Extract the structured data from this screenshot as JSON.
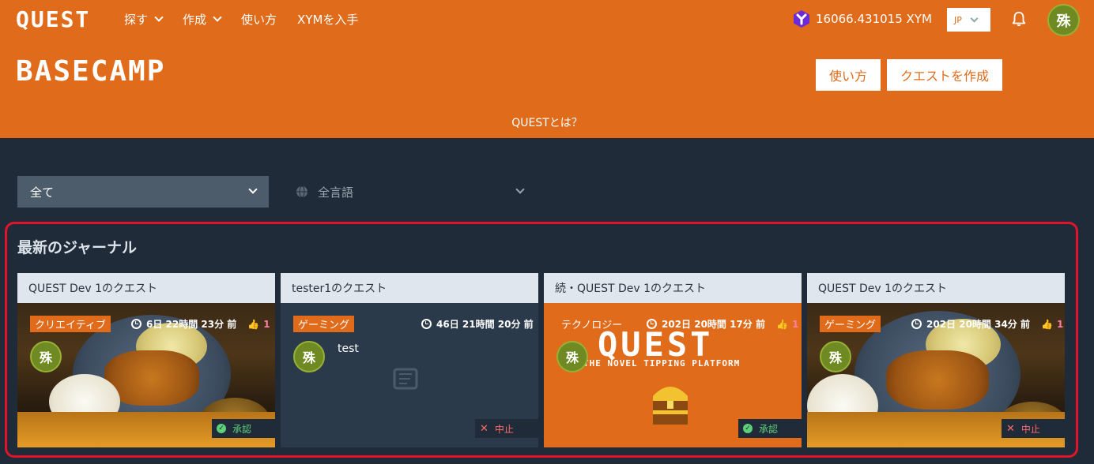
{
  "header": {
    "logo": "QUEST",
    "nav": [
      {
        "label": "探す",
        "dropdown": true
      },
      {
        "label": "作成",
        "dropdown": true
      },
      {
        "label": "使い方",
        "dropdown": false
      },
      {
        "label": "XYMを入手",
        "dropdown": false
      }
    ],
    "balance": "16066.431015 XYM",
    "language": "JP",
    "avatar_char": "殊"
  },
  "hero": {
    "title": "BASECAMP",
    "howto_button": "使い方",
    "create_button": "クエストを作成",
    "what_is_quest": "QUESTとは？"
  },
  "filters": {
    "category": "全て",
    "language": "全言語"
  },
  "journal": {
    "title": "最新のジャーナル",
    "cards": [
      {
        "owner": "QUEST Dev 1のクエスト",
        "tag": "クリエイティブ",
        "time": "6日 22時間 23分 前",
        "likes": "1",
        "text": "",
        "status": "承認",
        "status_type": "ok",
        "background": "food-photo"
      },
      {
        "owner": "tester1のクエスト",
        "tag": "ゲーミング",
        "time": "46日 21時間 20分 前",
        "likes": "",
        "text": "test",
        "status": "中止",
        "status_type": "ng",
        "background": "plain"
      },
      {
        "owner": "続・QUEST Dev 1のクエスト",
        "tag": "テクノロジー",
        "time": "202日 20時間 17分 前",
        "likes": "1",
        "text": "",
        "status": "承認",
        "status_type": "ok",
        "background": "quest-promo",
        "promo_title": "QUEST",
        "promo_subtitle": "THE NOVEL TIPPING PLATFORM"
      },
      {
        "owner": "QUEST Dev 1のクエスト",
        "tag": "ゲーミング",
        "time": "202日 20時間 34分 前",
        "likes": "1",
        "text": "",
        "status": "中止",
        "status_type": "ng",
        "background": "food-photo"
      }
    ]
  },
  "colors": {
    "brand_orange": "#e06b1a",
    "page_bg": "#1f2b38",
    "highlight_red": "#e0142b"
  }
}
